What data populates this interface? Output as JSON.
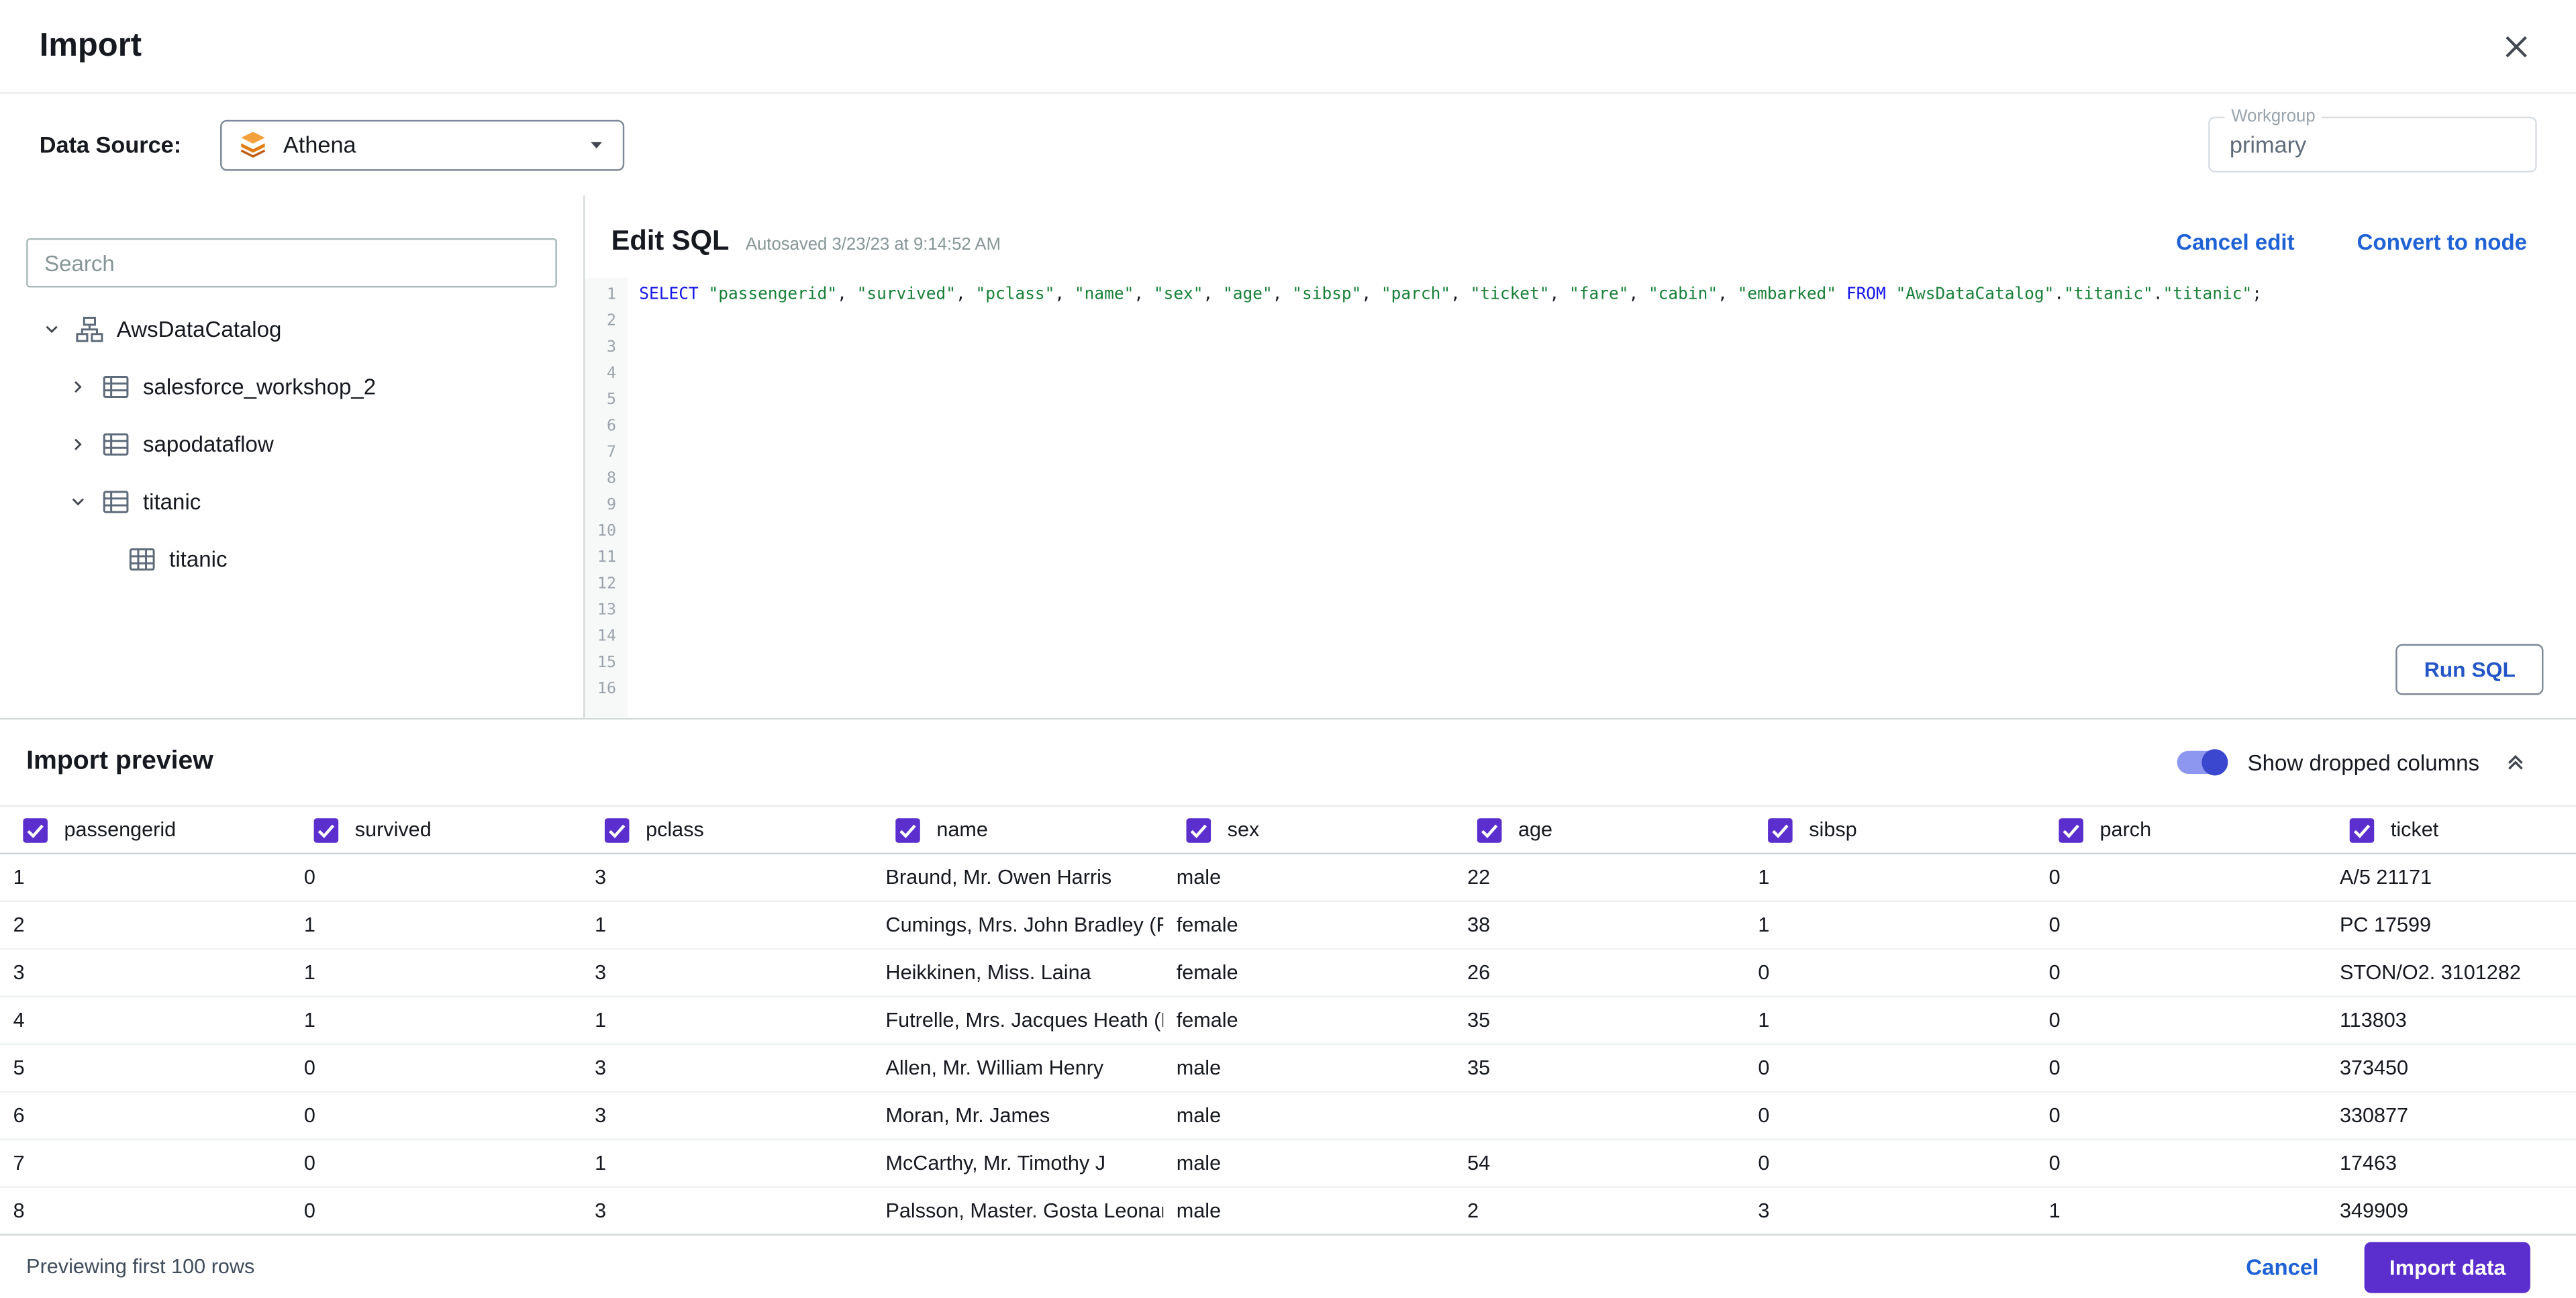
{
  "colors": {
    "accent_purple": "#5b2fce",
    "link_blue": "#1f62d5",
    "sql_keyword": "#1414e8",
    "sql_string": "#188038",
    "toggle_track": "#8d97ef",
    "toggle_thumb": "#3c47cf"
  },
  "header": {
    "title": "Import"
  },
  "datasource": {
    "label": "Data Source:",
    "selected": "Athena",
    "workgroup_label": "Workgroup",
    "workgroup_value": "primary"
  },
  "sidebar": {
    "search_placeholder": "Search",
    "tree": [
      {
        "label": "AwsDataCatalog",
        "level": 0,
        "expanded": true,
        "icon": "catalog"
      },
      {
        "label": "salesforce_workshop_2",
        "level": 1,
        "expanded": false,
        "icon": "database"
      },
      {
        "label": "sapodataflow",
        "level": 1,
        "expanded": false,
        "icon": "database"
      },
      {
        "label": "titanic",
        "level": 1,
        "expanded": true,
        "icon": "database"
      },
      {
        "label": "titanic",
        "level": 2,
        "expanded": null,
        "icon": "table"
      }
    ]
  },
  "editor": {
    "title": "Edit SQL",
    "autosaved": "Autosaved 3/23/23 at 9:14:52 AM",
    "cancel_edit_label": "Cancel edit",
    "convert_label": "Convert to node",
    "run_sql_label": "Run SQL",
    "line_count": 16,
    "sql_tokens": [
      {
        "text": "SELECT",
        "type": "kw"
      },
      {
        "text": " ",
        "type": "plain"
      },
      {
        "text": "\"passengerid\"",
        "type": "str"
      },
      {
        "text": ", ",
        "type": "plain"
      },
      {
        "text": "\"survived\"",
        "type": "str"
      },
      {
        "text": ", ",
        "type": "plain"
      },
      {
        "text": "\"pclass\"",
        "type": "str"
      },
      {
        "text": ", ",
        "type": "plain"
      },
      {
        "text": "\"name\"",
        "type": "str"
      },
      {
        "text": ", ",
        "type": "plain"
      },
      {
        "text": "\"sex\"",
        "type": "str"
      },
      {
        "text": ", ",
        "type": "plain"
      },
      {
        "text": "\"age\"",
        "type": "str"
      },
      {
        "text": ", ",
        "type": "plain"
      },
      {
        "text": "\"sibsp\"",
        "type": "str"
      },
      {
        "text": ", ",
        "type": "plain"
      },
      {
        "text": "\"parch\"",
        "type": "str"
      },
      {
        "text": ", ",
        "type": "plain"
      },
      {
        "text": "\"ticket\"",
        "type": "str"
      },
      {
        "text": ", ",
        "type": "plain"
      },
      {
        "text": "\"fare\"",
        "type": "str"
      },
      {
        "text": ", ",
        "type": "plain"
      },
      {
        "text": "\"cabin\"",
        "type": "str"
      },
      {
        "text": ", ",
        "type": "plain"
      },
      {
        "text": "\"embarked\"",
        "type": "str"
      },
      {
        "text": " ",
        "type": "plain"
      },
      {
        "text": "FROM",
        "type": "kw"
      },
      {
        "text": " ",
        "type": "plain"
      },
      {
        "text": "\"AwsDataCatalog\"",
        "type": "str"
      },
      {
        "text": ".",
        "type": "plain"
      },
      {
        "text": "\"titanic\"",
        "type": "str"
      },
      {
        "text": ".",
        "type": "plain"
      },
      {
        "text": "\"titanic\"",
        "type": "str"
      },
      {
        "text": ";",
        "type": "plain"
      }
    ]
  },
  "preview": {
    "title": "Import preview",
    "toggle_label": "Show dropped columns",
    "toggle_on": true,
    "columns": [
      "passengerid",
      "survived",
      "pclass",
      "name",
      "sex",
      "age",
      "sibsp",
      "parch",
      "ticket"
    ],
    "rows": [
      [
        "1",
        "0",
        "3",
        "Braund, Mr. Owen Harris",
        "male",
        "22",
        "1",
        "0",
        "A/5 21171"
      ],
      [
        "2",
        "1",
        "1",
        "Cumings, Mrs. John Bradley (Florenc",
        "female",
        "38",
        "1",
        "0",
        "PC 17599"
      ],
      [
        "3",
        "1",
        "3",
        "Heikkinen, Miss. Laina",
        "female",
        "26",
        "0",
        "0",
        "STON/O2. 3101282"
      ],
      [
        "4",
        "1",
        "1",
        "Futrelle, Mrs. Jacques Heath (Lily Ma",
        "female",
        "35",
        "1",
        "0",
        "113803"
      ],
      [
        "5",
        "0",
        "3",
        "Allen, Mr. William Henry",
        "male",
        "35",
        "0",
        "0",
        "373450"
      ],
      [
        "6",
        "0",
        "3",
        "Moran, Mr. James",
        "male",
        "",
        "0",
        "0",
        "330877"
      ],
      [
        "7",
        "0",
        "1",
        "McCarthy, Mr. Timothy J",
        "male",
        "54",
        "0",
        "0",
        "17463"
      ],
      [
        "8",
        "0",
        "3",
        "Palsson, Master. Gosta Leonard",
        "male",
        "2",
        "3",
        "1",
        "349909"
      ]
    ]
  },
  "footer": {
    "status": "Previewing first 100 rows",
    "cancel_label": "Cancel",
    "import_label": "Import data"
  }
}
